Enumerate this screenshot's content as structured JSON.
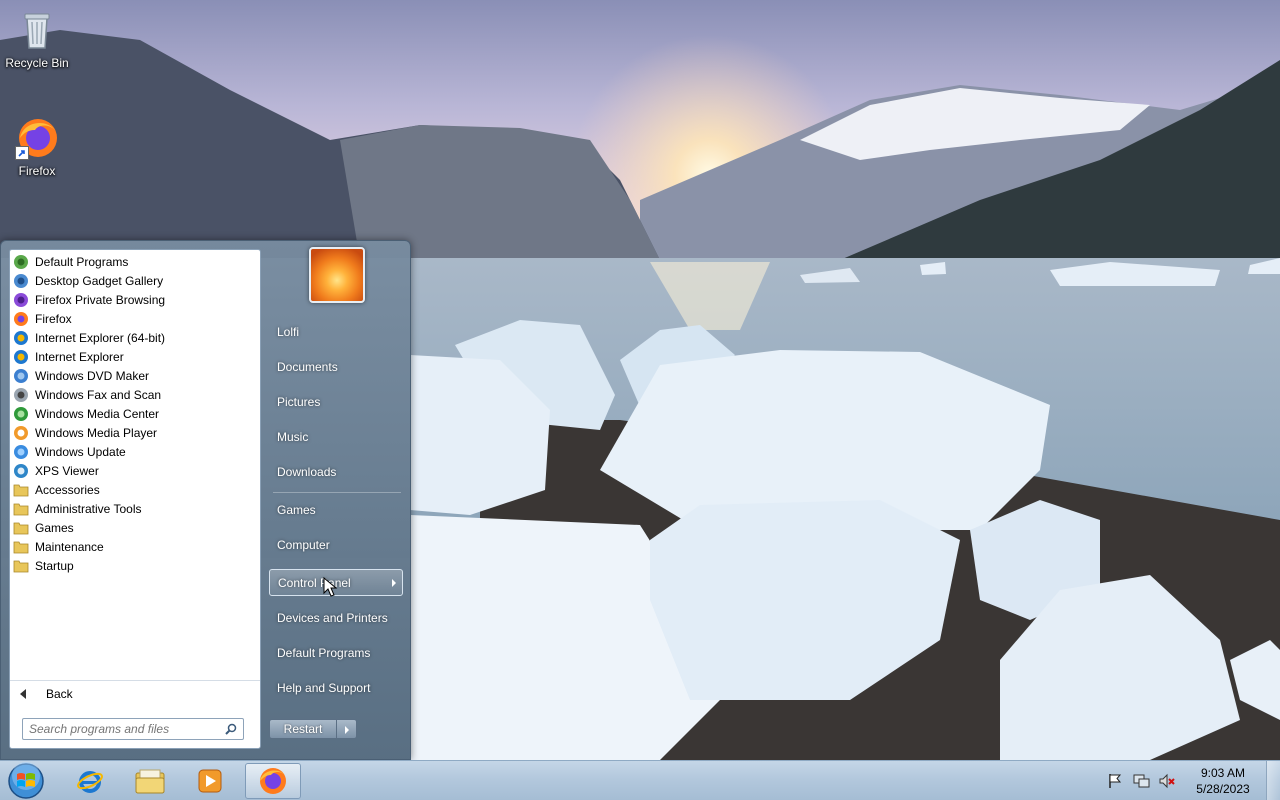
{
  "desktop": {
    "icons": [
      {
        "label": "Recycle Bin",
        "icon": "recycle-bin-icon"
      },
      {
        "label": "Firefox",
        "icon": "firefox-icon"
      }
    ]
  },
  "start_menu": {
    "programs": [
      {
        "label": "Default Programs",
        "icon": "default-programs-icon"
      },
      {
        "label": "Desktop Gadget Gallery",
        "icon": "gadget-gallery-icon"
      },
      {
        "label": "Firefox Private Browsing",
        "icon": "firefox-private-icon"
      },
      {
        "label": "Firefox",
        "icon": "firefox-icon"
      },
      {
        "label": "Internet Explorer (64-bit)",
        "icon": "internet-explorer-icon"
      },
      {
        "label": "Internet Explorer",
        "icon": "internet-explorer-icon"
      },
      {
        "label": "Windows DVD Maker",
        "icon": "dvd-maker-icon"
      },
      {
        "label": "Windows Fax and Scan",
        "icon": "fax-scan-icon"
      },
      {
        "label": "Windows Media Center",
        "icon": "media-center-icon"
      },
      {
        "label": "Windows Media Player",
        "icon": "media-player-icon"
      },
      {
        "label": "Windows Update",
        "icon": "windows-update-icon"
      },
      {
        "label": "XPS Viewer",
        "icon": "xps-viewer-icon"
      },
      {
        "label": "Accessories",
        "icon": "folder-icon"
      },
      {
        "label": "Administrative Tools",
        "icon": "folder-icon"
      },
      {
        "label": "Games",
        "icon": "folder-icon"
      },
      {
        "label": "Maintenance",
        "icon": "folder-icon"
      },
      {
        "label": "Startup",
        "icon": "folder-icon"
      }
    ],
    "back_label": "Back",
    "search_placeholder": "Search programs and files",
    "right_items": [
      {
        "label": "Lolfi"
      },
      {
        "label": "Documents"
      },
      {
        "label": "Pictures"
      },
      {
        "label": "Music"
      },
      {
        "label": "Downloads"
      },
      {
        "label": "Games"
      },
      {
        "label": "Computer"
      },
      {
        "label": "Control Panel"
      },
      {
        "label": "Devices and Printers"
      },
      {
        "label": "Default Programs"
      },
      {
        "label": "Help and Support"
      }
    ],
    "restart_label": "Restart"
  },
  "taskbar": {
    "pinned": [
      {
        "icon": "internet-explorer-icon"
      },
      {
        "icon": "file-explorer-icon"
      },
      {
        "icon": "media-player-icon"
      },
      {
        "icon": "firefox-icon"
      }
    ],
    "tray_icons": [
      "action-center-flag-icon",
      "network-icon",
      "volume-muted-icon"
    ],
    "time": "9:03 AM",
    "date": "5/28/2023"
  }
}
